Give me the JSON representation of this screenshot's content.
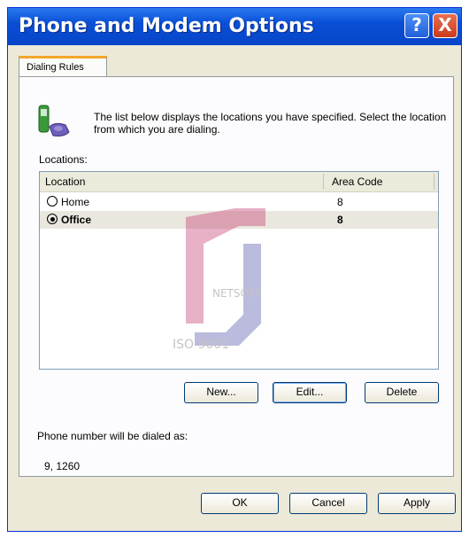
{
  "window": {
    "title": "Phone and Modem Options",
    "help_glyph": "?",
    "close_glyph": "X"
  },
  "tabs": [
    {
      "label": "Dialing Rules"
    }
  ],
  "dialing_rules": {
    "description": "The list below displays the locations you have specified. Select the location from which you are dialing.",
    "locations_label": "Locations:",
    "columns": {
      "location": "Location",
      "area_code": "Area Code"
    },
    "rows": [
      {
        "name": "Home",
        "area_code": "8",
        "selected": false
      },
      {
        "name": "Office",
        "area_code": "8",
        "selected": true
      }
    ],
    "buttons": {
      "new": "New...",
      "edit": "Edit...",
      "delete": "Delete"
    },
    "dial_label": "Phone number will be dialed as:",
    "dial_value": "9, 1260"
  },
  "footer": {
    "ok": "OK",
    "cancel": "Cancel",
    "apply": "Apply"
  },
  "watermark_text": {
    "line1": "NETSOFT",
    "line2": "ISO 9001"
  },
  "colors": {
    "title_bar": "#0a4fd6",
    "close_button": "#c93b1a",
    "tab_highlight": "#f4a52c",
    "selected_row": "#e9e7de"
  },
  "icons": {
    "location_icon": "phone-icon",
    "radio_on": "radio-selected-icon",
    "radio_off": "radio-unselected-icon"
  }
}
